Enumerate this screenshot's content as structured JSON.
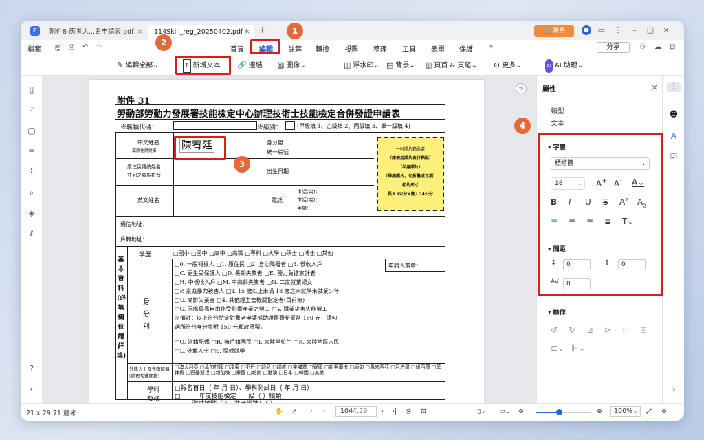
{
  "window": {
    "tabs": [
      {
        "label": "附件8-應考人...名申請表.pdf"
      },
      {
        "label": "114Skill_reg_20250402.pdf *"
      }
    ],
    "buy_label": "購買",
    "share_label": "分享"
  },
  "menu": {
    "file": "檔案",
    "items": [
      "首頁",
      "編輯",
      "註解",
      "轉換",
      "視圖",
      "整理",
      "工具",
      "表單",
      "保護"
    ]
  },
  "toolbar": {
    "edit_all": "編輯全部",
    "add_text": "新增文本",
    "link": "連結",
    "image": "圖像",
    "watermark": "浮水印",
    "background": "背景",
    "header_footer": "頁首 & 頁尾",
    "more": "更多",
    "ai": "AI 助理"
  },
  "badges": [
    "1",
    "2",
    "3",
    "4"
  ],
  "document": {
    "appendix": "附件 31",
    "heading": "勞動部勞動力發展署技能檢定中心辦理技術士技能檢定合併發證申請表",
    "job_code": "※職類代碼：",
    "level": "※級別：",
    "level_options": "(甲級填 1、乙級填 2、丙級填 3、單一級填 4)",
    "chinese_name": "中文姓名",
    "chinese_name_sub": "或原住民姓名",
    "name_value": "陳宥廷",
    "id_label": "身分證",
    "id_label2": "統一編號",
    "birth": "出生日期",
    "orig_name": "原住民傳統姓名",
    "orig_name2": "並列之羅馬拼音",
    "english_name": "英文姓名",
    "phone": "電話",
    "phone_city": "市話(公)：",
    "phone_home": "市話(宅)：",
    "mobile": "手機：",
    "comm_addr": "通信地址：",
    "reg_addr": "戶籍地址：",
    "education": "學歷",
    "edu_options": "□國小 □國中 □高中 □高職 □專科 □大學 □碩士 □博士 □其他",
    "identity": "身分別",
    "applicant_sig": "申請人簽章：",
    "basic_info": "基本資料(必填欄位請詳填)",
    "id_lines": [
      "□0. 一般報檢人    □1. 原住民    □2. 身心障礙者    □3. 低收入戶",
      "□C. 更生受保護人    □D. 長期失業者    □E. 獨力負擔家計者",
      "□H. 中低收入戶    □M. 中高齡失業者    □N. 二度就業婦女",
      "□P. 家庭暴力被害人 □T. 15 歲以上未滿 18 歲之未就學未就業少年",
      "□U. 高齡失業者    □4. 其他經主管機關指定者(目前無)",
      "□G. 因應貿易自由化受影響產業之勞工    □V. 職業災害失能勞工",
      "※備註：以上符合特定對象者申請補助證照費新臺幣 160 元，請勾",
      "選所符合身分並附 150 元郵政匯票。",
      "□Q. 外籍配偶  □R. 無戶籍國民  □I. 大陸學位生  □K. 大陸地區人民",
      "□L. 外籍人士  □S. 探親就學"
    ],
    "foreign_spouse": "外籍人士及外籍配偶(請再勾選國籍)",
    "countries": "□澳大利亞 □孟加拉國 □汶萊 □不丹 □印尼 □印度 □柬埔寨 □寮國 □新里蘭卡 □緬甸 □馬來西亞 □尼泊爾 □紐西蘭 □菲律賓 □巴基斯坦 □新加坡 □泰國 □越南 □港澳 □日本 □韓國 □其他",
    "subject": "學科及格",
    "subject_line1": "□報名首日（    年    月    日）、學科測試日（    年    月    日）",
    "subject_line2": "□______年度技能檢定____級（                    ）職類",
    "subject_line3": "，測試地點（                    ），准考證號：（                    ）",
    "photo_lines": [
      "一吋照片黏貼處",
      "（請使用照片自行黏貼）",
      "（半身照片）",
      "（掃描照片，勿折疊或污損）",
      "相片尺寸",
      "長3.5公分×寬2.54公分"
    ]
  },
  "properties": {
    "title": "屬性",
    "type_label": "類型",
    "type_value": "文本",
    "font_section": "字體",
    "font_name": "標楷體",
    "font_size": "18",
    "spacing_section": "間距",
    "line_spacing": "0",
    "para_spacing": "0",
    "char_spacing": "0",
    "action_section": "動作"
  },
  "status": {
    "page_size": "21 x 29.71 釐米",
    "page_current": "104",
    "page_total": "/129",
    "zoom": "100%"
  },
  "colors": {
    "accent": "#2d62d8",
    "highlight_red": "#d81e1e",
    "badge": "#e3683a",
    "photo_box": "#fdf07a"
  }
}
